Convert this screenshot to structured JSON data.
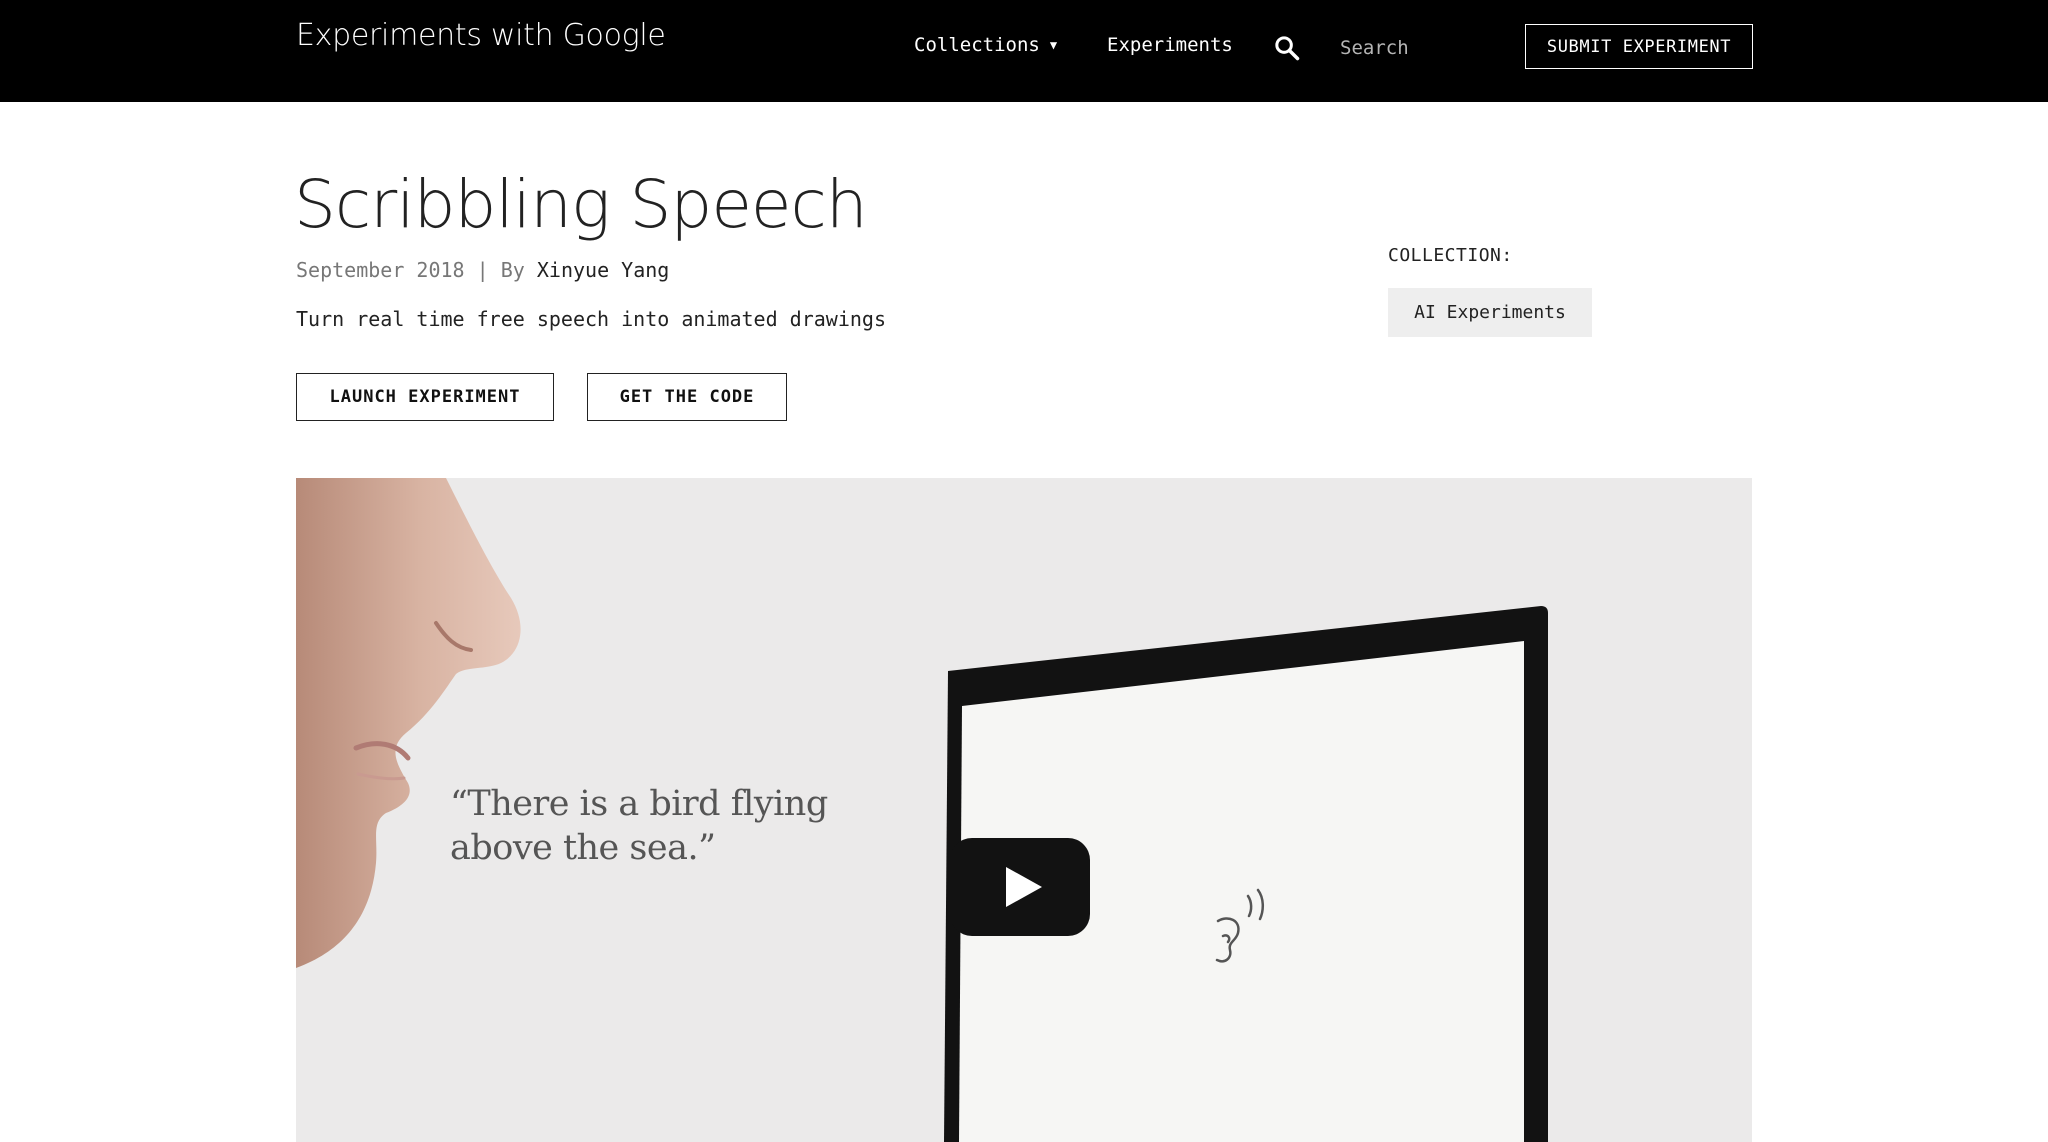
{
  "header": {
    "brand": "Experiments with Google",
    "nav": {
      "collections_label": "Collections",
      "experiments_label": "Experiments"
    },
    "search": {
      "placeholder": "Search",
      "value": ""
    },
    "submit_label": "SUBMIT EXPERIMENT"
  },
  "experiment": {
    "title": "Scribbling Speech",
    "date": "September 2018",
    "separator": "|",
    "by_label": "By",
    "author": "Xinyue Yang",
    "description": "Turn real time free speech into animated drawings",
    "launch_label": "LAUNCH EXPERIMENT",
    "code_label": "GET THE CODE"
  },
  "collection": {
    "label": "COLLECTION:",
    "name": "AI Experiments"
  },
  "video": {
    "quote_line1": "“There is a bird flying",
    "quote_line2": "above the sea.”"
  },
  "colors": {
    "nav_background": "#000000",
    "chip_background": "#eeeeee",
    "video_background": "#ebeaea"
  }
}
